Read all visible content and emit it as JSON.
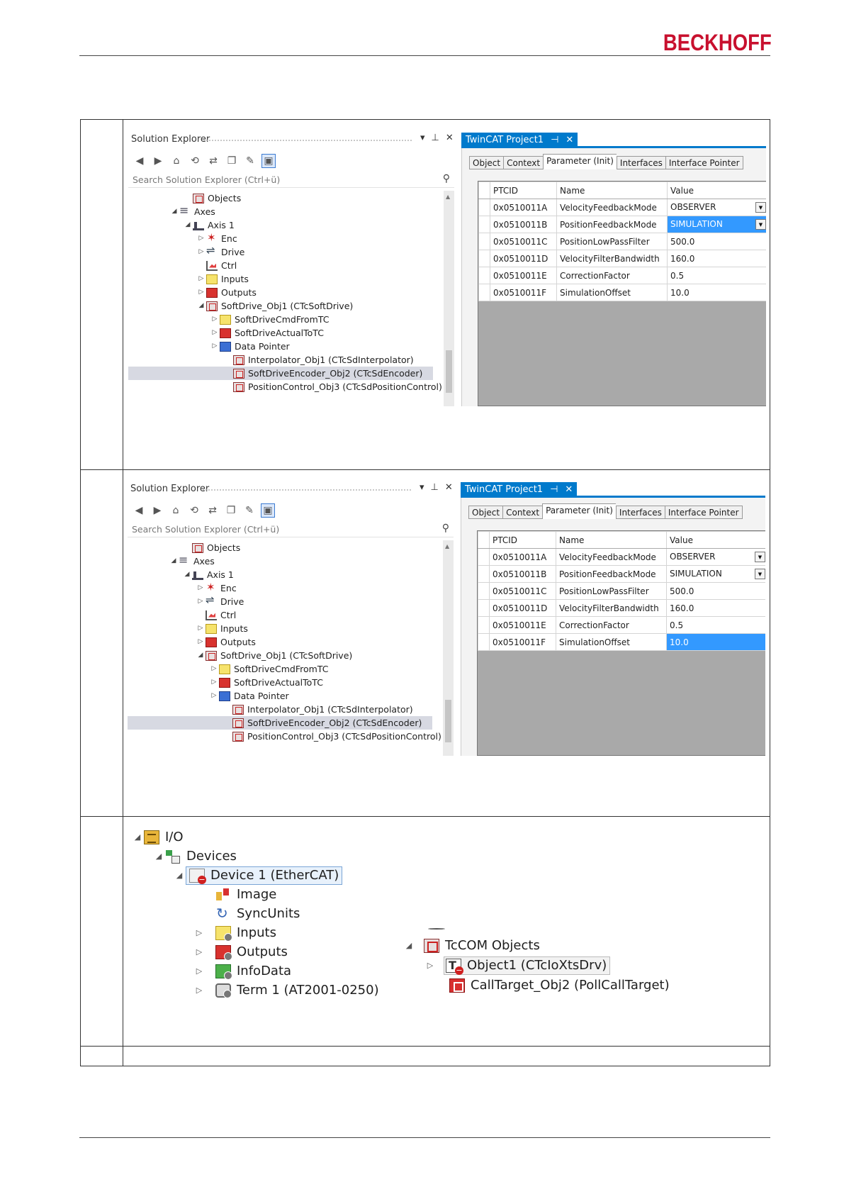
{
  "header": {
    "logo": "BECKHOFF"
  },
  "screens": [
    {
      "solution_explorer": {
        "title": "Solution Explorer",
        "search_placeholder": "Search Solution Explorer (Ctrl+ü)",
        "tree": [
          {
            "label": "Objects",
            "icon": "objects-icon",
            "level": 3,
            "arrow": ""
          },
          {
            "label": "Axes",
            "icon": "axes-icon",
            "level": 2,
            "arrow": "◢"
          },
          {
            "label": "Axis 1",
            "icon": "axis-icon",
            "level": 3,
            "arrow": "◢"
          },
          {
            "label": "Enc",
            "icon": "encoder-icon",
            "level": 4,
            "arrow": "▷"
          },
          {
            "label": "Drive",
            "icon": "drive-icon",
            "level": 4,
            "arrow": "▷"
          },
          {
            "label": "Ctrl",
            "icon": "controller-icon",
            "level": 4,
            "arrow": ""
          },
          {
            "label": "Inputs",
            "icon": "inputs-icon",
            "level": 4,
            "arrow": "▷"
          },
          {
            "label": "Outputs",
            "icon": "outputs-icon",
            "level": 4,
            "arrow": "▷"
          },
          {
            "label": "SoftDrive_Obj1 (CTcSoftDrive)",
            "icon": "tcom-object-icon",
            "level": 4,
            "arrow": "◢"
          },
          {
            "label": "SoftDriveCmdFromTC",
            "icon": "inputs-icon",
            "level": 5,
            "arrow": "▷"
          },
          {
            "label": "SoftDriveActualToTC",
            "icon": "outputs-icon",
            "level": 5,
            "arrow": "▷"
          },
          {
            "label": "Data Pointer",
            "icon": "data-pointer-icon",
            "level": 5,
            "arrow": "▷"
          },
          {
            "label": "Interpolator_Obj1 (CTcSdInterpolator)",
            "icon": "tcom-object-icon",
            "level": 6,
            "arrow": ""
          },
          {
            "label": "SoftDriveEncoder_Obj2 (CTcSdEncoder)",
            "icon": "tcom-object-icon",
            "level": 6,
            "arrow": "",
            "selected": true
          },
          {
            "label": "PositionControl_Obj3 (CTcSdPositionControl)",
            "icon": "tcom-object-icon",
            "level": 6,
            "arrow": ""
          }
        ]
      },
      "twincat": {
        "tab_title": "TwinCAT Project1",
        "subtabs": [
          "Object",
          "Context",
          "Parameter (Init)",
          "Interfaces",
          "Interface Pointer"
        ],
        "active_subtab": 2,
        "columns": [
          "PTCID",
          "Name",
          "Value"
        ],
        "rows": [
          {
            "ptcid": "0x0510011A",
            "name": "VelocityFeedbackMode",
            "value": "OBSERVER",
            "dropdown": true
          },
          {
            "ptcid": "0x0510011B",
            "name": "PositionFeedbackMode",
            "value": "SIMULATION",
            "dropdown": true,
            "selected": true
          },
          {
            "ptcid": "0x0510011C",
            "name": "PositionLowPassFilter",
            "value": "500.0"
          },
          {
            "ptcid": "0x0510011D",
            "name": "VelocityFilterBandwidth",
            "value": "160.0"
          },
          {
            "ptcid": "0x0510011E",
            "name": "CorrectionFactor",
            "value": "0.5"
          },
          {
            "ptcid": "0x0510011F",
            "name": "SimulationOffset",
            "value": "10.0"
          }
        ]
      }
    },
    {
      "solution_explorer": {
        "title": "Solution Explorer",
        "search_placeholder": "Search Solution Explorer (Ctrl+ü)",
        "tree": [
          {
            "label": "Objects",
            "icon": "objects-icon",
            "level": 3,
            "arrow": ""
          },
          {
            "label": "Axes",
            "icon": "axes-icon",
            "level": 2,
            "arrow": "◢"
          },
          {
            "label": "Axis 1",
            "icon": "axis-icon",
            "level": 3,
            "arrow": "◢"
          },
          {
            "label": "Enc",
            "icon": "encoder-icon",
            "level": 4,
            "arrow": "▷"
          },
          {
            "label": "Drive",
            "icon": "drive-icon",
            "level": 4,
            "arrow": "▷"
          },
          {
            "label": "Ctrl",
            "icon": "controller-icon",
            "level": 4,
            "arrow": ""
          },
          {
            "label": "Inputs",
            "icon": "inputs-icon",
            "level": 4,
            "arrow": "▷"
          },
          {
            "label": "Outputs",
            "icon": "outputs-icon",
            "level": 4,
            "arrow": "▷"
          },
          {
            "label": "SoftDrive_Obj1 (CTcSoftDrive)",
            "icon": "tcom-object-icon",
            "level": 4,
            "arrow": "◢"
          },
          {
            "label": "SoftDriveCmdFromTC",
            "icon": "inputs-icon",
            "level": 5,
            "arrow": "▷"
          },
          {
            "label": "SoftDriveActualToTC",
            "icon": "outputs-icon",
            "level": 5,
            "arrow": "▷"
          },
          {
            "label": "Data Pointer",
            "icon": "data-pointer-icon",
            "level": 5,
            "arrow": "▷"
          },
          {
            "label": "Interpolator_Obj1 (CTcSdInterpolator)",
            "icon": "tcom-object-icon",
            "level": 6,
            "arrow": ""
          },
          {
            "label": "SoftDriveEncoder_Obj2 (CTcSdEncoder)",
            "icon": "tcom-object-icon",
            "level": 6,
            "arrow": "",
            "selected": true
          },
          {
            "label": "PositionControl_Obj3 (CTcSdPositionControl)",
            "icon": "tcom-object-icon",
            "level": 6,
            "arrow": ""
          }
        ]
      },
      "twincat": {
        "tab_title": "TwinCAT Project1",
        "subtabs": [
          "Object",
          "Context",
          "Parameter (Init)",
          "Interfaces",
          "Interface Pointer"
        ],
        "active_subtab": 2,
        "columns": [
          "PTCID",
          "Name",
          "Value"
        ],
        "rows": [
          {
            "ptcid": "0x0510011A",
            "name": "VelocityFeedbackMode",
            "value": "OBSERVER",
            "dropdown": true
          },
          {
            "ptcid": "0x0510011B",
            "name": "PositionFeedbackMode",
            "value": "SIMULATION",
            "dropdown": true
          },
          {
            "ptcid": "0x0510011C",
            "name": "PositionLowPassFilter",
            "value": "500.0"
          },
          {
            "ptcid": "0x0510011D",
            "name": "VelocityFilterBandwidth",
            "value": "160.0"
          },
          {
            "ptcid": "0x0510011E",
            "name": "CorrectionFactor",
            "value": "0.5"
          },
          {
            "ptcid": "0x0510011F",
            "name": "SimulationOffset",
            "value": "10.0",
            "selected": true
          }
        ]
      }
    }
  ],
  "io_tree": {
    "io": "I/O",
    "devices": "Devices",
    "device1": "Device 1 (EtherCAT)",
    "image": "Image",
    "syncunits": "SyncUnits",
    "inputs": "Inputs",
    "outputs": "Outputs",
    "infodata": "InfoData",
    "term1": "Term 1 (AT2001-0250)"
  },
  "tcom_tree": {
    "root": "TcCOM Objects",
    "object1": "Object1 (CTcIoXtsDrv)",
    "calltarget": "CallTarget_Obj2 (PollCallTarget)"
  },
  "colors": {
    "brand_red": "#c8102e",
    "vs_blue": "#007acc",
    "selection": "#3399ff"
  }
}
